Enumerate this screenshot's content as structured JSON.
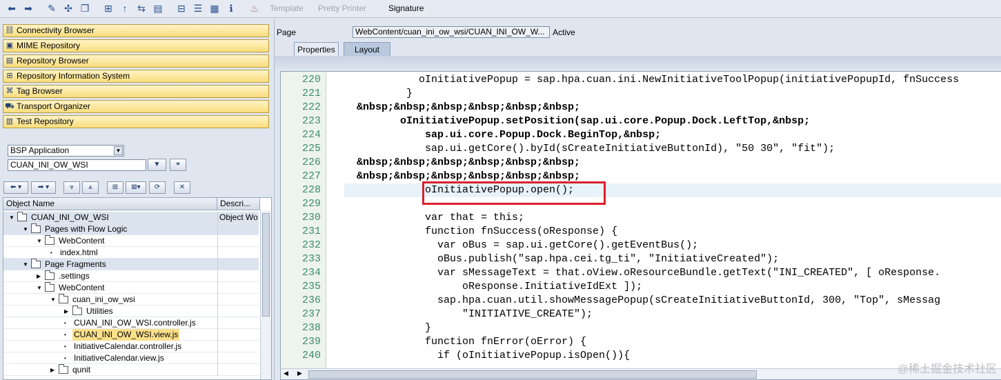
{
  "toolbar": {
    "icons": [
      "back-arrow-icon",
      "forward-arrow-icon",
      "check-syntax-icon",
      "activate-icon",
      "display-object-icon",
      "hierarchy-icon",
      "where-used-icon",
      "navigate-icon",
      "window-icon",
      "tree-icon",
      "stack-icon",
      "layout-icon",
      "info-icon",
      "pretty-printer-icon"
    ],
    "template_label": "Template",
    "pretty_printer_label": "Pretty Printer",
    "signature_label": "Signature"
  },
  "browsers": [
    {
      "label": "Connectivity Browser",
      "icon": "connectivity-icon"
    },
    {
      "label": "MIME Repository",
      "icon": "mime-icon"
    },
    {
      "label": "Repository Browser",
      "icon": "repository-icon"
    },
    {
      "label": "Repository Information System",
      "icon": "info-system-icon"
    },
    {
      "label": "Tag Browser",
      "icon": "tag-icon"
    },
    {
      "label": "Transport Organizer",
      "icon": "transport-icon"
    },
    {
      "label": "Test Repository",
      "icon": "test-icon"
    }
  ],
  "object_type": {
    "value": "BSP Application"
  },
  "object_name": {
    "value": "CUAN_INI_OW_WSI"
  },
  "tree": {
    "col_name": "Object Name",
    "col_desc": "Descri...",
    "rows": [
      {
        "label": "CUAN_INI_OW_WSI",
        "desc": "Object Wo",
        "level": 0,
        "arrow": "▼",
        "folder": true
      },
      {
        "label": "Pages with Flow Logic",
        "desc": "",
        "level": 1,
        "arrow": "▼",
        "folder": true
      },
      {
        "label": "WebContent",
        "desc": "",
        "level": 2,
        "arrow": "▼",
        "folder": true
      },
      {
        "label": "index.html",
        "desc": "",
        "level": 3,
        "arrow": "•",
        "folder": false
      },
      {
        "label": "Page Fragments",
        "desc": "",
        "level": 1,
        "arrow": "▼",
        "folder": true
      },
      {
        "label": ".settings",
        "desc": "",
        "level": 2,
        "arrow": "▶",
        "folder": true
      },
      {
        "label": "WebContent",
        "desc": "",
        "level": 2,
        "arrow": "▼",
        "folder": true
      },
      {
        "label": "cuan_ini_ow_wsi",
        "desc": "",
        "level": 3,
        "arrow": "▼",
        "folder": true
      },
      {
        "label": "Utilities",
        "desc": "",
        "level": 4,
        "arrow": "▶",
        "folder": true
      },
      {
        "label": "CUAN_INI_OW_WSI.controller.js",
        "desc": "",
        "level": 4,
        "arrow": "•",
        "folder": false
      },
      {
        "label": "CUAN_INI_OW_WSI.view.js",
        "desc": "",
        "level": 4,
        "arrow": "•",
        "folder": false,
        "highlight": true
      },
      {
        "label": "InitiativeCalendar.controller.js",
        "desc": "",
        "level": 4,
        "arrow": "•",
        "folder": false
      },
      {
        "label": "InitiativeCalendar.view.js",
        "desc": "",
        "level": 4,
        "arrow": "•",
        "folder": false
      },
      {
        "label": "qunit",
        "desc": "",
        "level": 3,
        "arrow": "▶",
        "folder": true
      }
    ]
  },
  "page": {
    "label": "Page",
    "value": "WebContent/cuan_ini_ow_wsi/CUAN_INI_OW_W...",
    "status": "Active"
  },
  "tabs": [
    {
      "label": "Properties",
      "active": false
    },
    {
      "label": "Layout",
      "active": true
    }
  ],
  "code": {
    "lines": [
      {
        "num": "220",
        "text": "            oInitiativePopup = sap.hpa.cuan.ini.NewInitiativeToolPopup(initiativePopupId, fnSuccess"
      },
      {
        "num": "221",
        "text": "          }"
      },
      {
        "num": "222",
        "text": "  &nbsp;&nbsp;&nbsp;&nbsp;&nbsp;&nbsp;"
      },
      {
        "num": "223",
        "text": "         oInitiativePopup.setPosition(sap.ui.core.Popup.Dock.LeftTop,&nbsp;"
      },
      {
        "num": "224",
        "text": "             sap.ui.core.Popup.Dock.BeginTop,&nbsp;"
      },
      {
        "num": "225",
        "text": "             sap.ui.getCore().byId(sCreateInitiativeButtonId), \"50 30\", \"fit\");"
      },
      {
        "num": "226",
        "text": "  &nbsp;&nbsp;&nbsp;&nbsp;&nbsp;&nbsp;"
      },
      {
        "num": "227",
        "text": "  &nbsp;&nbsp;&nbsp;&nbsp;&nbsp;&nbsp;"
      },
      {
        "num": "228",
        "text": "             oInitiativePopup.open();"
      },
      {
        "num": "229",
        "text": ""
      },
      {
        "num": "230",
        "text": "             var that = this;"
      },
      {
        "num": "231",
        "text": "             function fnSuccess(oResponse) {"
      },
      {
        "num": "232",
        "text": "               var oBus = sap.ui.getCore().getEventBus();"
      },
      {
        "num": "233",
        "text": "               oBus.publish(\"sap.hpa.cei.tg_ti\", \"InitiativeCreated\");"
      },
      {
        "num": "234",
        "text": "               var sMessageText = that.oView.oResourceBundle.getText(\"INI_CREATED\", [ oResponse."
      },
      {
        "num": "235",
        "text": "                   oResponse.InitiativeIdExt ]);"
      },
      {
        "num": "236",
        "text": "               sap.hpa.cuan.util.showMessagePopup(sCreateInitiativeButtonId, 300, \"Top\", sMessag"
      },
      {
        "num": "237",
        "text": "                   \"INITIATIVE_CREATE\");"
      },
      {
        "num": "238",
        "text": "             }"
      },
      {
        "num": "239",
        "text": "             function fnError(oError) {"
      },
      {
        "num": "240",
        "text": "               if (oInitiativePopup.isOpen()){"
      }
    ],
    "current_line": "228"
  },
  "watermark": "@稀土掘金技术社区"
}
